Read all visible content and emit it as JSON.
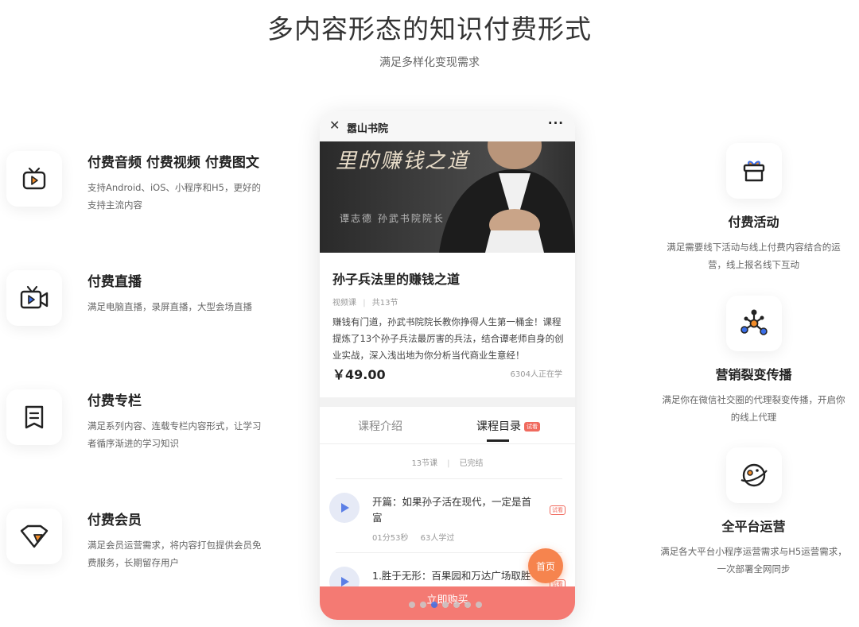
{
  "header": {
    "title": "多内容形态的知识付费形式",
    "subtitle": "满足多样化变现需求"
  },
  "left_features": [
    {
      "icon": "tv-play-icon",
      "title": "付费音频 付费视频 付费图文",
      "desc": "支持Android、iOS、小程序和H5，更好的支持主流内容"
    },
    {
      "icon": "video-camera-icon",
      "title": "付费直播",
      "desc": "满足电脑直播，录屏直播，大型会场直播"
    },
    {
      "icon": "column-book-icon",
      "title": "付费专栏",
      "desc": "满足系列内容、连载专栏内容形式，让学习者循序渐进的学习知识"
    },
    {
      "icon": "diamond-icon",
      "title": "付费会员",
      "desc": "满足会员运营需求，将内容打包提供会员免费服务，长期留存用户"
    }
  ],
  "right_features": [
    {
      "icon": "gift-icon",
      "title": "付费活动",
      "desc": "满足需要线下活动与线上付费内容结合的运营，线上报名线下互动"
    },
    {
      "icon": "network-icon",
      "title": "营销裂变传播",
      "desc": "满足你在微信社交圈的代理裂变传播，开启你的线上代理"
    },
    {
      "icon": "planet-icon",
      "title": "全平台运营",
      "desc": "满足各大平台小程序运营需求与H5运营需求，一次部署全网同步"
    }
  ],
  "phone": {
    "close_glyph": "✕",
    "app_title": "嚣山书院",
    "more_glyph": "···",
    "banner_text": "里的赚钱之道",
    "banner_sub": "谭志德  孙武书院院长",
    "course_title": "孙子兵法里的赚钱之道",
    "meta_type": "视频课",
    "meta_count": "共13节",
    "description": "赚钱有门道，孙武书院院长教你挣得人生第一桶金！课程提炼了13个孙子兵法最厉害的兵法，结合谭老师自身的创业实战，深入浅出地为你分析当代商业生意经！",
    "price": "￥49.00",
    "learners": "6304人正在学",
    "tab_intro": "课程介绍",
    "tab_catalog": "课程目录",
    "tab_badge": "试看",
    "stats_lessons": "13节课",
    "stats_status": "已完结",
    "lessons": [
      {
        "title": "开篇：如果孙子活在现代，一定是首富",
        "badge": "试看",
        "duration": "01分53秒",
        "learners": "63人学过"
      },
      {
        "title": "1.胜于无形：百果园和万达广场取胜",
        "badge": "试看",
        "duration": "",
        "learners": ""
      }
    ],
    "home_button": "首页",
    "buy_button": "立即购买",
    "carousel": {
      "total": 7,
      "active": 2
    }
  },
  "colors": {
    "accent": "#f47a73",
    "home": "#f6844e",
    "icon_orange": "#f28c28",
    "icon_blue": "#3a6ee8"
  }
}
